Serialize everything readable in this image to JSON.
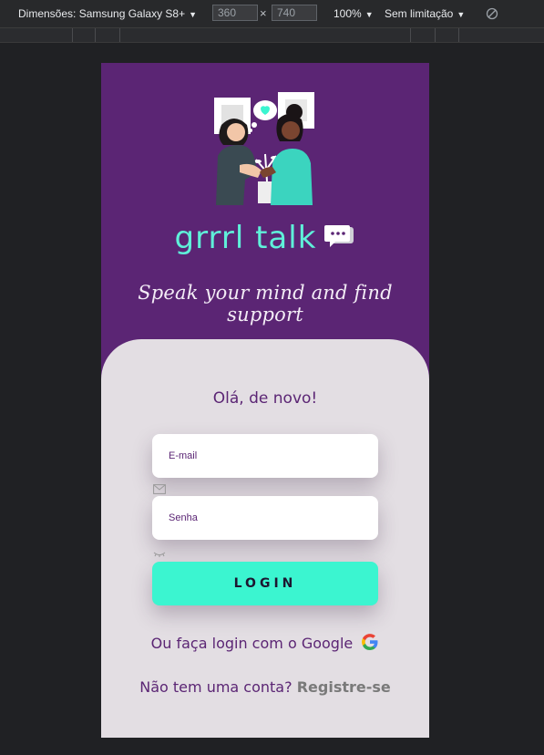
{
  "devtools": {
    "dimensions_label": "Dimensões: Samsung Galaxy S8+",
    "width_value": "360",
    "height_value": "740",
    "times_symbol": "×",
    "zoom": "100%",
    "throttle": "Sem limitação"
  },
  "app": {
    "logo_text": "grrrl talk",
    "tagline": "Speak your mind and find support",
    "greeting": "Olá, de novo!",
    "email_placeholder": "E-mail",
    "password_placeholder": "Senha",
    "login_label": "LOGIN",
    "google_text": "Ou faça login com o Google",
    "register_prompt": "Não tem uma conta?",
    "register_link": "Registre-se"
  },
  "colors": {
    "brand_purple": "#5b2574",
    "accent_teal": "#3bf5d0",
    "card_bg": "#e3dee3"
  },
  "icons": [
    "chevron-down-icon",
    "rotate-icon",
    "chat-bubble-icon",
    "envelope-icon",
    "eye-closed-icon",
    "google-icon"
  ]
}
